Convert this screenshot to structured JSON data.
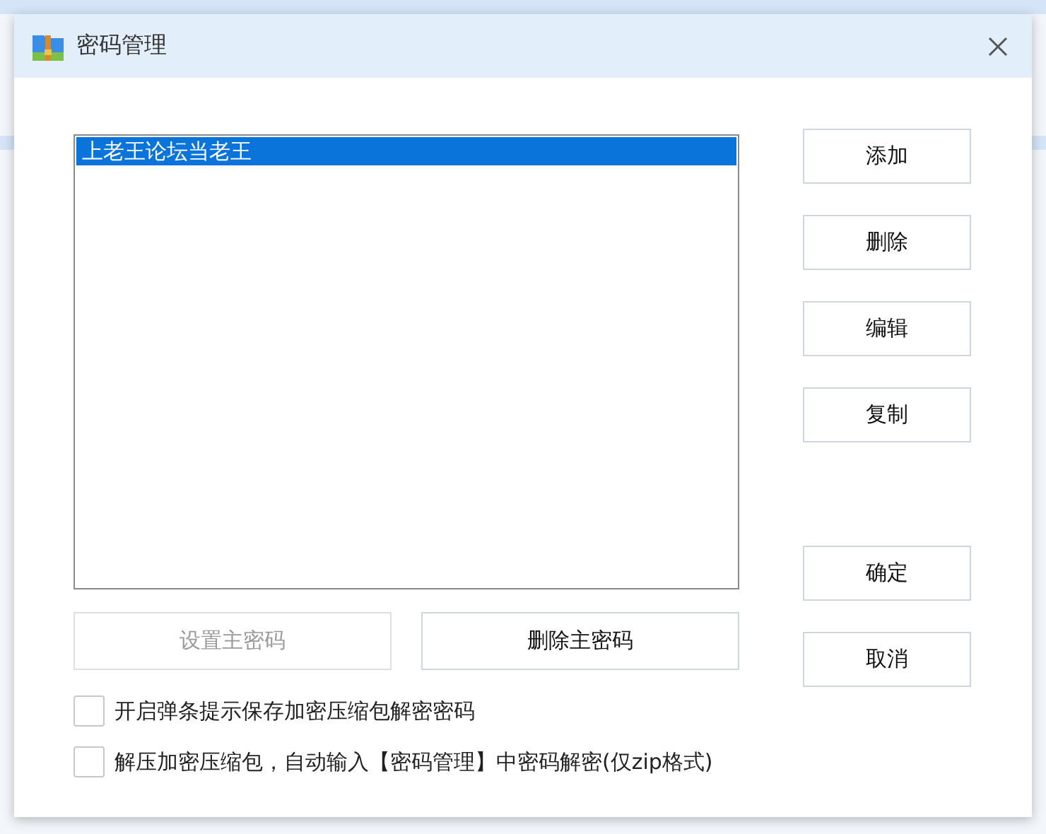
{
  "window": {
    "title": "密码管理"
  },
  "passwords": [
    {
      "label": "上老王论坛当老王",
      "selected": true
    }
  ],
  "action_buttons": [
    "添加",
    "删除",
    "编辑",
    "复制"
  ],
  "dialog_buttons": [
    "确定",
    "取消"
  ],
  "master_buttons": [
    {
      "label": "设置主密码",
      "disabled": true
    },
    {
      "label": "删除主密码",
      "disabled": false
    }
  ],
  "options": [
    {
      "label": "开启弹条提示保存加密压缩包解密密码",
      "checked": false
    },
    {
      "label": "解压加密压缩包，自动输入【密码管理】中密码解密(仅zip格式)",
      "checked": false
    }
  ]
}
